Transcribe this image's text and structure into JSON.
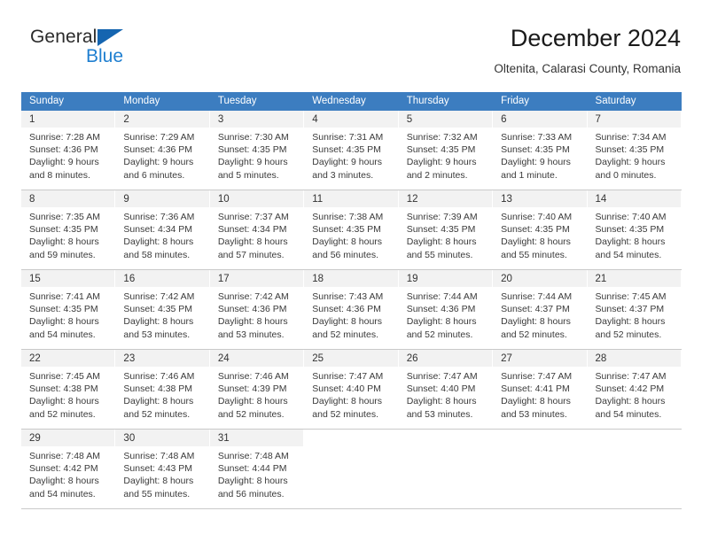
{
  "brand": {
    "word1": "General",
    "word2": "Blue",
    "triangle_color": "#1565b0",
    "blue_color": "#1f7fd0"
  },
  "header": {
    "title": "December 2024",
    "location": "Oltenita, Calarasi County, Romania"
  },
  "calendar": {
    "header_color": "#3c7dc0",
    "daynum_bar_color": "#f2f2f2",
    "weekday_headers": [
      "Sunday",
      "Monday",
      "Tuesday",
      "Wednesday",
      "Thursday",
      "Friday",
      "Saturday"
    ],
    "weeks": [
      [
        {
          "day": "1",
          "lines": [
            "Sunrise: 7:28 AM",
            "Sunset: 4:36 PM",
            "Daylight: 9 hours",
            "and 8 minutes."
          ]
        },
        {
          "day": "2",
          "lines": [
            "Sunrise: 7:29 AM",
            "Sunset: 4:36 PM",
            "Daylight: 9 hours",
            "and 6 minutes."
          ]
        },
        {
          "day": "3",
          "lines": [
            "Sunrise: 7:30 AM",
            "Sunset: 4:35 PM",
            "Daylight: 9 hours",
            "and 5 minutes."
          ]
        },
        {
          "day": "4",
          "lines": [
            "Sunrise: 7:31 AM",
            "Sunset: 4:35 PM",
            "Daylight: 9 hours",
            "and 3 minutes."
          ]
        },
        {
          "day": "5",
          "lines": [
            "Sunrise: 7:32 AM",
            "Sunset: 4:35 PM",
            "Daylight: 9 hours",
            "and 2 minutes."
          ]
        },
        {
          "day": "6",
          "lines": [
            "Sunrise: 7:33 AM",
            "Sunset: 4:35 PM",
            "Daylight: 9 hours",
            "and 1 minute."
          ]
        },
        {
          "day": "7",
          "lines": [
            "Sunrise: 7:34 AM",
            "Sunset: 4:35 PM",
            "Daylight: 9 hours",
            "and 0 minutes."
          ]
        }
      ],
      [
        {
          "day": "8",
          "lines": [
            "Sunrise: 7:35 AM",
            "Sunset: 4:35 PM",
            "Daylight: 8 hours",
            "and 59 minutes."
          ]
        },
        {
          "day": "9",
          "lines": [
            "Sunrise: 7:36 AM",
            "Sunset: 4:34 PM",
            "Daylight: 8 hours",
            "and 58 minutes."
          ]
        },
        {
          "day": "10",
          "lines": [
            "Sunrise: 7:37 AM",
            "Sunset: 4:34 PM",
            "Daylight: 8 hours",
            "and 57 minutes."
          ]
        },
        {
          "day": "11",
          "lines": [
            "Sunrise: 7:38 AM",
            "Sunset: 4:35 PM",
            "Daylight: 8 hours",
            "and 56 minutes."
          ]
        },
        {
          "day": "12",
          "lines": [
            "Sunrise: 7:39 AM",
            "Sunset: 4:35 PM",
            "Daylight: 8 hours",
            "and 55 minutes."
          ]
        },
        {
          "day": "13",
          "lines": [
            "Sunrise: 7:40 AM",
            "Sunset: 4:35 PM",
            "Daylight: 8 hours",
            "and 55 minutes."
          ]
        },
        {
          "day": "14",
          "lines": [
            "Sunrise: 7:40 AM",
            "Sunset: 4:35 PM",
            "Daylight: 8 hours",
            "and 54 minutes."
          ]
        }
      ],
      [
        {
          "day": "15",
          "lines": [
            "Sunrise: 7:41 AM",
            "Sunset: 4:35 PM",
            "Daylight: 8 hours",
            "and 54 minutes."
          ]
        },
        {
          "day": "16",
          "lines": [
            "Sunrise: 7:42 AM",
            "Sunset: 4:35 PM",
            "Daylight: 8 hours",
            "and 53 minutes."
          ]
        },
        {
          "day": "17",
          "lines": [
            "Sunrise: 7:42 AM",
            "Sunset: 4:36 PM",
            "Daylight: 8 hours",
            "and 53 minutes."
          ]
        },
        {
          "day": "18",
          "lines": [
            "Sunrise: 7:43 AM",
            "Sunset: 4:36 PM",
            "Daylight: 8 hours",
            "and 52 minutes."
          ]
        },
        {
          "day": "19",
          "lines": [
            "Sunrise: 7:44 AM",
            "Sunset: 4:36 PM",
            "Daylight: 8 hours",
            "and 52 minutes."
          ]
        },
        {
          "day": "20",
          "lines": [
            "Sunrise: 7:44 AM",
            "Sunset: 4:37 PM",
            "Daylight: 8 hours",
            "and 52 minutes."
          ]
        },
        {
          "day": "21",
          "lines": [
            "Sunrise: 7:45 AM",
            "Sunset: 4:37 PM",
            "Daylight: 8 hours",
            "and 52 minutes."
          ]
        }
      ],
      [
        {
          "day": "22",
          "lines": [
            "Sunrise: 7:45 AM",
            "Sunset: 4:38 PM",
            "Daylight: 8 hours",
            "and 52 minutes."
          ]
        },
        {
          "day": "23",
          "lines": [
            "Sunrise: 7:46 AM",
            "Sunset: 4:38 PM",
            "Daylight: 8 hours",
            "and 52 minutes."
          ]
        },
        {
          "day": "24",
          "lines": [
            "Sunrise: 7:46 AM",
            "Sunset: 4:39 PM",
            "Daylight: 8 hours",
            "and 52 minutes."
          ]
        },
        {
          "day": "25",
          "lines": [
            "Sunrise: 7:47 AM",
            "Sunset: 4:40 PM",
            "Daylight: 8 hours",
            "and 52 minutes."
          ]
        },
        {
          "day": "26",
          "lines": [
            "Sunrise: 7:47 AM",
            "Sunset: 4:40 PM",
            "Daylight: 8 hours",
            "and 53 minutes."
          ]
        },
        {
          "day": "27",
          "lines": [
            "Sunrise: 7:47 AM",
            "Sunset: 4:41 PM",
            "Daylight: 8 hours",
            "and 53 minutes."
          ]
        },
        {
          "day": "28",
          "lines": [
            "Sunrise: 7:47 AM",
            "Sunset: 4:42 PM",
            "Daylight: 8 hours",
            "and 54 minutes."
          ]
        }
      ],
      [
        {
          "day": "29",
          "lines": [
            "Sunrise: 7:48 AM",
            "Sunset: 4:42 PM",
            "Daylight: 8 hours",
            "and 54 minutes."
          ]
        },
        {
          "day": "30",
          "lines": [
            "Sunrise: 7:48 AM",
            "Sunset: 4:43 PM",
            "Daylight: 8 hours",
            "and 55 minutes."
          ]
        },
        {
          "day": "31",
          "lines": [
            "Sunrise: 7:48 AM",
            "Sunset: 4:44 PM",
            "Daylight: 8 hours",
            "and 56 minutes."
          ]
        },
        {
          "day": "",
          "lines": []
        },
        {
          "day": "",
          "lines": []
        },
        {
          "day": "",
          "lines": []
        },
        {
          "day": "",
          "lines": []
        }
      ]
    ]
  }
}
